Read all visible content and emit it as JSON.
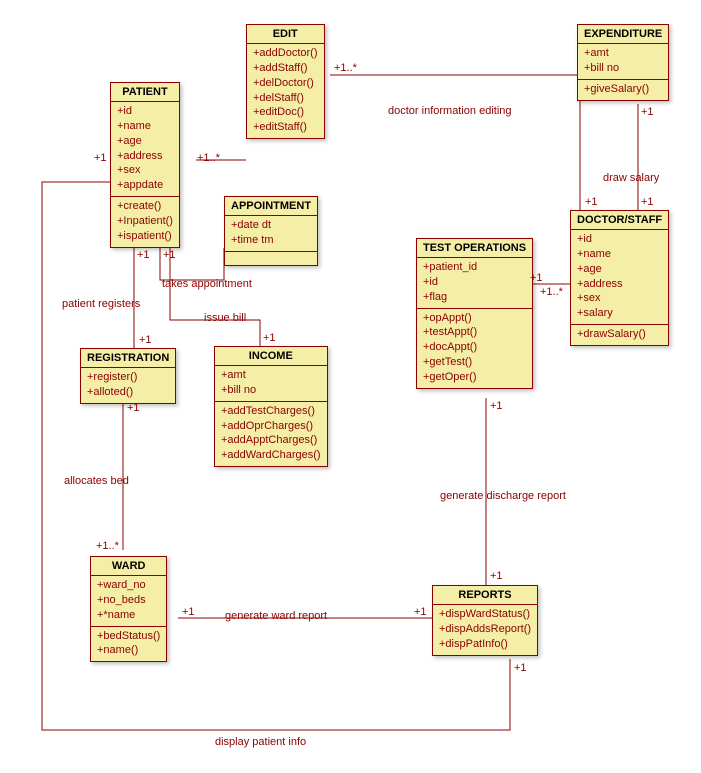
{
  "classes": {
    "edit": {
      "title": "EDIT",
      "attrs": [],
      "ops": [
        "+addDoctor()",
        "+addStaff()",
        "+delDoctor()",
        "+delStaff()",
        "+editDoc()",
        "+editStaff()"
      ]
    },
    "expenditure": {
      "title": "EXPENDITURE",
      "attrs": [
        "+amt",
        "+bill no"
      ],
      "ops": [
        "+giveSalary()"
      ]
    },
    "patient": {
      "title": "PATIENT",
      "attrs": [
        "+id",
        "+name",
        "+age",
        "+address",
        "+sex",
        "+appdate"
      ],
      "ops": [
        "+create()",
        "+Inpatient()",
        "+ispatient()"
      ]
    },
    "appointment": {
      "title": "APPOINTMENT",
      "attrs": [
        "+date dt",
        "+time tm"
      ],
      "ops": []
    },
    "doctorstaff": {
      "title": "DOCTOR/STAFF",
      "attrs": [
        "+id",
        "+name",
        "+age",
        "+address",
        "+sex",
        "+salary"
      ],
      "ops": [
        "+drawSalary()"
      ]
    },
    "testops": {
      "title": "TEST OPERATIONS",
      "attrs": [
        "+patient_id",
        "+id",
        "+flag"
      ],
      "ops": [
        "+opAppt()",
        "+testAppt()",
        "+docAppt()",
        "+getTest()",
        "+getOper()"
      ]
    },
    "registration": {
      "title": "REGISTRATION",
      "attrs": [],
      "ops": [
        "+register()",
        "+alloted()"
      ]
    },
    "income": {
      "title": "INCOME",
      "attrs": [
        "+amt",
        "+bill no"
      ],
      "ops": [
        "+addTestCharges()",
        "+addOprCharges()",
        "+addApptCharges()",
        "+addWardCharges()"
      ]
    },
    "ward": {
      "title": "WARD",
      "attrs": [
        "+ward_no",
        "+no_beds",
        "+*name"
      ],
      "ops": [
        "+bedStatus()",
        "+name()"
      ]
    },
    "reports": {
      "title": "REPORTS",
      "attrs": [],
      "ops": [
        "+dispWardStatus()",
        "+dispAddsReport()",
        "+dispPatInfo()"
      ]
    }
  },
  "labels": {
    "docInfoEditing": "doctor information editing",
    "drawSalary": "draw salary",
    "takesAppointment": "takes appointment",
    "patientRegisters": "patient registers",
    "issueBill": "issue bill",
    "allocatesBed": "allocates bed",
    "generateWardReport": "generate ward report",
    "generateDischarge": "generate discharge report",
    "displayPatientInfo": "display patient info"
  },
  "mult": {
    "one": "+1",
    "oneStar": "+1..*",
    "starOne": "+1..*"
  },
  "chart_data": {
    "type": "table",
    "note": "UML class diagram — classes with attributes/operations and associations with multiplicities",
    "associations": [
      {
        "a": "EDIT",
        "b": "DOCTOR/STAFF",
        "label": "doctor information editing",
        "multA": "1..*",
        "multB": "1"
      },
      {
        "a": "EXPENDITURE",
        "b": "DOCTOR/STAFF",
        "label": "draw salary",
        "multA": "1",
        "multB": "1"
      },
      {
        "a": "PATIENT",
        "b": "APPOINTMENT",
        "label": "takes appointment",
        "multA": "1",
        "multB": ""
      },
      {
        "a": "PATIENT",
        "b": "REGISTRATION",
        "label": "patient registers",
        "multA": "1",
        "multB": "1"
      },
      {
        "a": "PATIENT",
        "b": "INCOME",
        "label": "issue bill",
        "multA": "1",
        "multB": "1"
      },
      {
        "a": "REGISTRATION",
        "b": "WARD",
        "label": "allocates bed",
        "multA": "1",
        "multB": "1..*"
      },
      {
        "a": "WARD",
        "b": "REPORTS",
        "label": "generate ward report",
        "multA": "1",
        "multB": "1"
      },
      {
        "a": "TEST OPERATIONS",
        "b": "REPORTS",
        "label": "generate discharge report",
        "multA": "1",
        "multB": "1"
      },
      {
        "a": "TEST OPERATIONS",
        "b": "DOCTOR/STAFF",
        "label": "",
        "multA": "1",
        "multB": "1..*"
      },
      {
        "a": "PATIENT",
        "b": "REPORTS",
        "label": "display patient info",
        "multA": "1",
        "multB": "1"
      },
      {
        "a": "PATIENT",
        "b": "EDIT",
        "label": "",
        "multA": "1..*",
        "multB": ""
      }
    ]
  }
}
